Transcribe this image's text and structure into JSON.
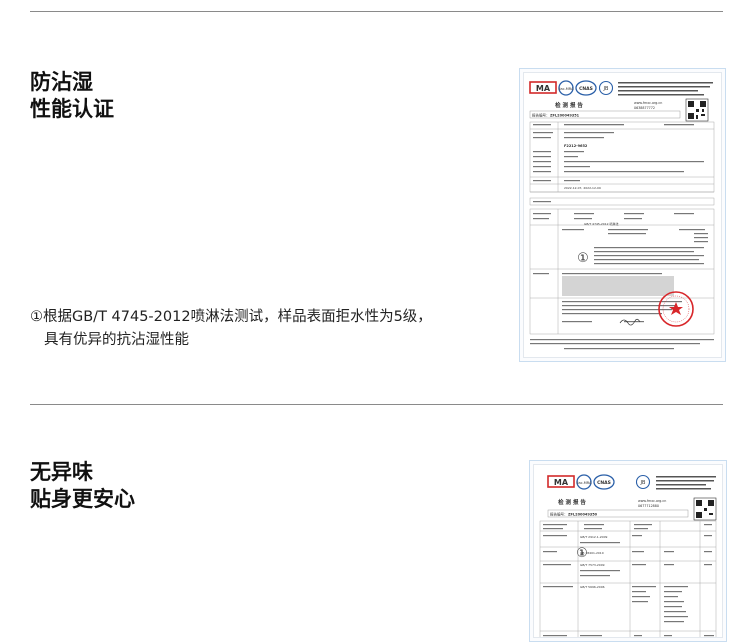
{
  "section1": {
    "title_line1": "防沾湿",
    "title_line2": "性能认证",
    "note_line1": "①根据GB/T 4745-2012喷淋法测试，样品表面拒水性为5级，",
    "note_line2": "具有优异的抗沾湿性能",
    "cert": {
      "heading": "检 测 报 告",
      "report_no_label": "报告编号：",
      "report_no": "ZFL200049351",
      "website": "www.fmxc.org.cn",
      "tel": "0638877772",
      "model": "F2212-9652",
      "color": "white",
      "dates": "2022-12-07, 2022-12-09",
      "standard": "GB/T 4745-2012 喷淋法",
      "marker": "①",
      "logo_ma": "MA",
      "logo_ilac": "ilac-MRA",
      "logo_cnas": "CNAS",
      "logo_jb": "JB"
    }
  },
  "section2": {
    "title_line1": "无异味",
    "title_line2": "贴身更安心",
    "cert": {
      "heading": "检 测 报 告",
      "report_no_label": "报告编号：",
      "report_no": "ZFL200049350",
      "website": "www.fmxc.org.cn",
      "tel": "0677712880",
      "standard1": "GB/T 2912.1-2009",
      "standard2": "GB 18401-2010",
      "standard3": "GB/T 7573-2009",
      "standard4": "GB/T 5696-2006",
      "marker": "①",
      "logo_ma": "MA",
      "logo_ilac": "ilac-MRA",
      "logo_cnas": "CNAS",
      "logo_jb": "JB"
    }
  },
  "colors": {
    "accent_red": "#d22a2a",
    "seal_red": "#d8262a",
    "rule": "#8a8a8a",
    "cert_border": "#c9ddf0"
  }
}
